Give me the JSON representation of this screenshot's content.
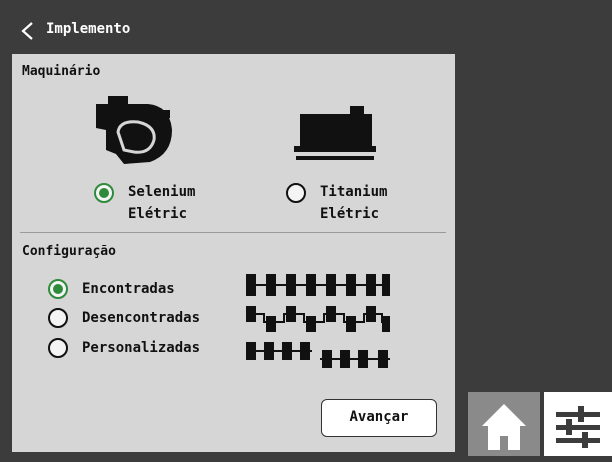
{
  "header": {
    "title": "Implemento",
    "back_icon": "chevron-left-icon"
  },
  "maquinario": {
    "title": "Maquinário",
    "options": [
      {
        "line1": "Selenium",
        "line2": "Elétric",
        "selected": true,
        "icon": "selenium-machine-icon"
      },
      {
        "line1": "Titanium",
        "line2": "Elétric",
        "selected": false,
        "icon": "titanium-machine-icon"
      }
    ]
  },
  "configuracao": {
    "title": "Configuração",
    "options": [
      {
        "label": "Encontradas",
        "selected": true,
        "pattern": "aligned-pattern-icon"
      },
      {
        "label": "Desencontradas",
        "selected": false,
        "pattern": "staggered-pattern-icon"
      },
      {
        "label": "Personalizadas",
        "selected": false,
        "pattern": "custom-pattern-icon"
      }
    ]
  },
  "actions": {
    "next_label": "Avançar"
  },
  "sidebar": {
    "home_icon": "home-icon",
    "settings_icon": "sliders-icon"
  },
  "colors": {
    "accent": "#2e8b3c",
    "background": "#3c3c3c",
    "panel": "#d6d6d6"
  }
}
